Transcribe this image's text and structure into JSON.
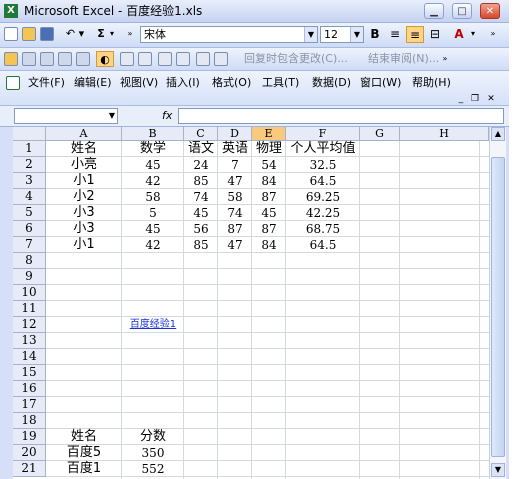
{
  "window": {
    "title": "Microsoft Excel - 百度经验1.xls",
    "app_icon": "excel-icon"
  },
  "toolbar1": {
    "font_name": "宋体",
    "font_size": "12",
    "bold_label": "B",
    "sum_label": "Σ",
    "font_color_label": "A"
  },
  "toolbar2": {
    "reply_label": "回复时包含更改(C)...",
    "end_review_label": "结束审阅(N)..."
  },
  "menu": {
    "items": [
      "文件(F)",
      "编辑(E)",
      "视图(V)",
      "插入(I)",
      "格式(O)",
      "工具(T)",
      "数据(D)",
      "窗口(W)",
      "帮助(H)"
    ]
  },
  "formula_bar": {
    "fx_label": "fx",
    "name_box": "",
    "content": ""
  },
  "sheet": {
    "columns": [
      "A",
      "B",
      "C",
      "D",
      "E",
      "F",
      "G",
      "H"
    ],
    "selected_column": "E",
    "rows": [
      "1",
      "2",
      "3",
      "4",
      "5",
      "6",
      "7",
      "8",
      "9",
      "10",
      "11",
      "12",
      "13",
      "14",
      "15",
      "16",
      "17",
      "18",
      "19",
      "20",
      "21"
    ],
    "table1_header": [
      "姓名",
      "数学",
      "语文",
      "英语",
      "物理",
      "个人平均值"
    ],
    "table1_rows": [
      [
        "小亮",
        "45",
        "24",
        "7",
        "54",
        "32.5"
      ],
      [
        "小1",
        "42",
        "85",
        "47",
        "84",
        "64.5"
      ],
      [
        "小2",
        "58",
        "74",
        "58",
        "87",
        "69.25"
      ],
      [
        "小3",
        "5",
        "45",
        "74",
        "45",
        "42.25"
      ],
      [
        "小3",
        "45",
        "56",
        "87",
        "87",
        "68.75"
      ],
      [
        "小1",
        "42",
        "85",
        "47",
        "84",
        "64.5"
      ]
    ],
    "link_text": "百度经验1",
    "table2_header": [
      "姓名",
      "分数"
    ],
    "table2_rows": [
      [
        "百度5",
        "350"
      ],
      [
        "百度1",
        "552"
      ]
    ]
  },
  "colors": {
    "selected_header": "#f9c97e",
    "toolbar": "#dbe5f8",
    "link": "#1a31d4"
  }
}
